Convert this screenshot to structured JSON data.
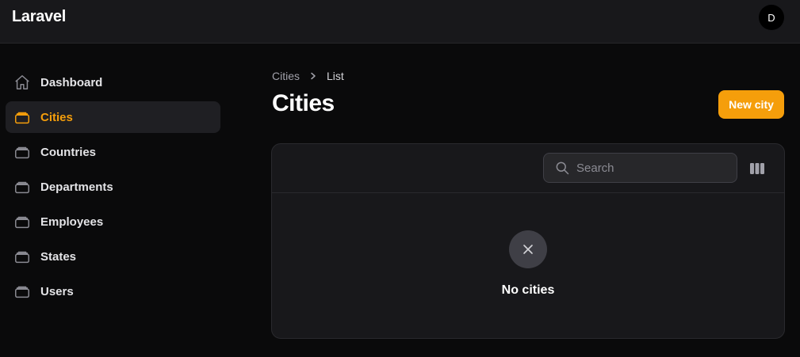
{
  "app": {
    "brand": "Laravel",
    "user_initial": "D"
  },
  "sidebar": {
    "items": [
      {
        "label": "Dashboard",
        "icon": "home-icon",
        "active": false
      },
      {
        "label": "Cities",
        "icon": "collection-icon",
        "active": true
      },
      {
        "label": "Countries",
        "icon": "collection-icon",
        "active": false
      },
      {
        "label": "Departments",
        "icon": "collection-icon",
        "active": false
      },
      {
        "label": "Employees",
        "icon": "collection-icon",
        "active": false
      },
      {
        "label": "States",
        "icon": "collection-icon",
        "active": false
      },
      {
        "label": "Users",
        "icon": "collection-icon",
        "active": false
      }
    ]
  },
  "breadcrumb": {
    "parent": "Cities",
    "current": "List"
  },
  "page": {
    "title": "Cities",
    "new_button": "New city"
  },
  "table": {
    "search_placeholder": "Search",
    "empty_message": "No cities"
  },
  "colors": {
    "accent": "#f59e0b",
    "background": "#0a0a0b",
    "panel": "#18181b"
  }
}
